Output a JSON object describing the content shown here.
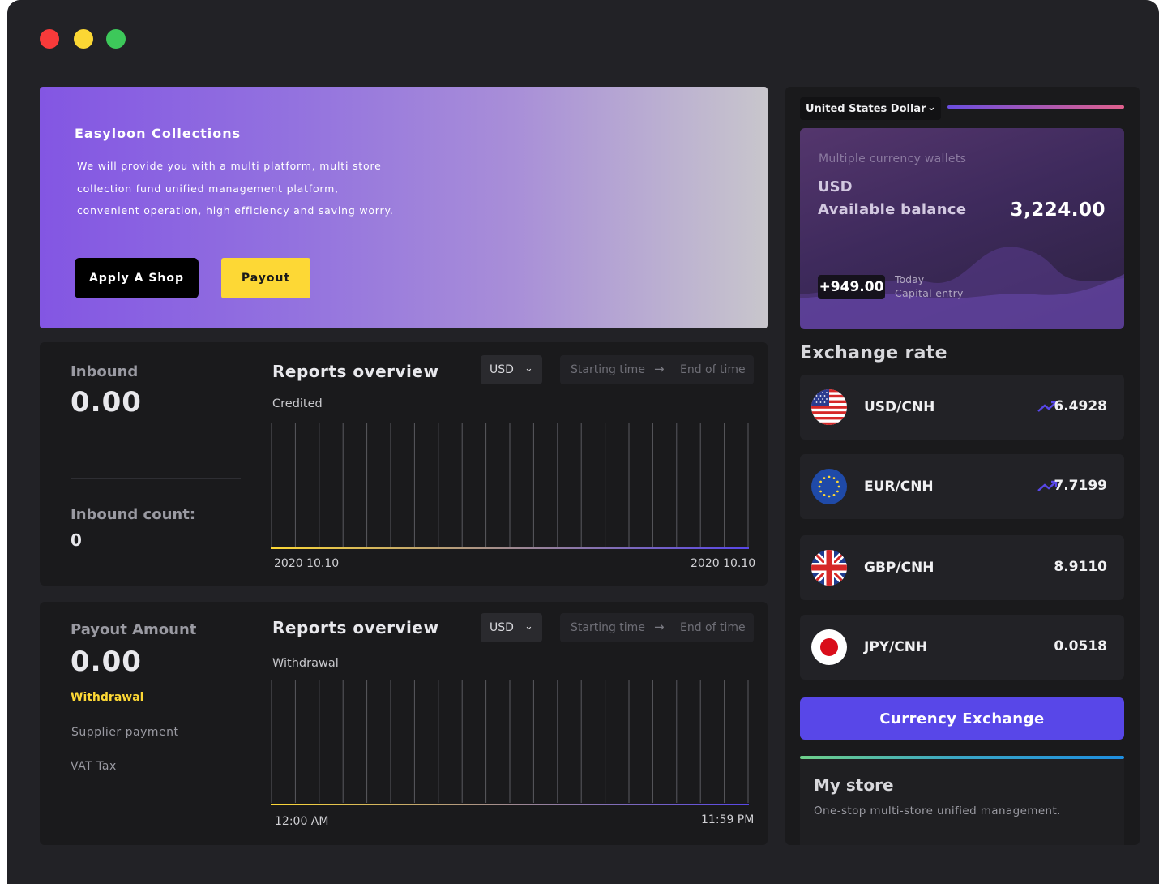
{
  "window": {
    "controls": [
      "close",
      "minimize",
      "maximize"
    ]
  },
  "hero": {
    "title": "Easyloon Collections",
    "description": "We will provide you with a multi platform, multi store collection fund unified management platform, convenient operation, high efficiency and saving worry.",
    "apply_label": "Apply A Shop",
    "payout_label": "Payout"
  },
  "inbound": {
    "label": "Inbound",
    "value": "0.00",
    "count_label": "Inbound count:",
    "count_value": "0",
    "report": {
      "title": "Reports overview",
      "subtitle": "Credited",
      "currency": "USD",
      "start_placeholder": "Starting time",
      "end_placeholder": "End of time",
      "x_start": "2020 10.10",
      "x_end": "2020 10.10"
    }
  },
  "payout": {
    "label": "Payout Amount",
    "value": "0.00",
    "tabs": [
      "Withdrawal",
      "Supplier payment",
      "VAT Tax"
    ],
    "report": {
      "title": "Reports overview",
      "subtitle": "Withdrawal",
      "currency": "USD",
      "start_placeholder": "Starting time",
      "end_placeholder": "End of time",
      "x_start": "12:00 AM",
      "x_end": "11:59 PM"
    }
  },
  "wallet": {
    "currency_select": "United States Dollar",
    "label": "Multiple currency wallets",
    "currency": "USD",
    "available_label": "Available balance",
    "balance": "3,224.00",
    "today_entry": "+949.00",
    "today_label": "Today",
    "capital_label": "Capital entry"
  },
  "exchange": {
    "title": "Exchange rate",
    "rates": [
      {
        "pair": "USD/CNH",
        "rate": "6.4928",
        "trend": "up",
        "flag": "us-flag-icon"
      },
      {
        "pair": "EUR/CNH",
        "rate": "7.7199",
        "trend": "up",
        "flag": "eu-flag-icon"
      },
      {
        "pair": "GBP/CNH",
        "rate": "8.9110",
        "trend": "none",
        "flag": "uk-flag-icon"
      },
      {
        "pair": "JPY/CNH",
        "rate": "0.0518",
        "trend": "none",
        "flag": "jp-flag-icon"
      }
    ],
    "button_label": "Currency Exchange"
  },
  "store": {
    "title": "My store",
    "description": "One-stop multi-store unified management."
  },
  "colors": {
    "accent_purple": "#5847e8",
    "accent_yellow": "#fdd835",
    "background": "#222226",
    "card": "#1a1a1c"
  }
}
